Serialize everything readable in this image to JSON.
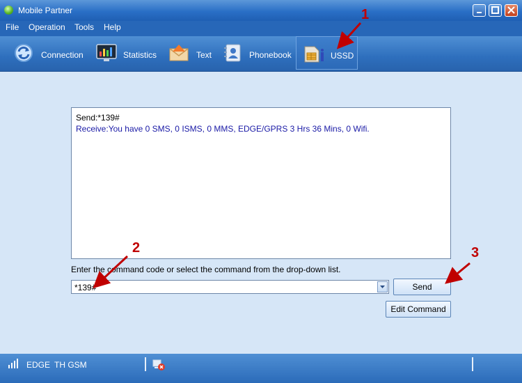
{
  "window": {
    "title": "Mobile Partner"
  },
  "menu": [
    {
      "label": "File"
    },
    {
      "label": "Operation"
    },
    {
      "label": "Tools"
    },
    {
      "label": "Help"
    }
  ],
  "toolbar": {
    "tabs": [
      {
        "label": "Connection",
        "icon": "connection-icon"
      },
      {
        "label": "Statistics",
        "icon": "statistics-icon"
      },
      {
        "label": "Text",
        "icon": "envelope-icon"
      },
      {
        "label": "Phonebook",
        "icon": "phonebook-icon"
      },
      {
        "label": "USSD",
        "icon": "ussd-sim-icon",
        "active": true
      }
    ]
  },
  "ussd": {
    "log": {
      "send_line": "Send:*139#",
      "receive_line": "Receive:You have 0 SMS, 0 ISMS, 0 MMS, EDGE/GPRS 3 Hrs 36 Mins, 0 Wifi."
    },
    "hint": "Enter the command code or select the command from the drop-down list.",
    "command_value": "*139#",
    "send_label": "Send",
    "edit_label": "Edit Command"
  },
  "status": {
    "network": "EDGE",
    "operator": "TH GSM"
  },
  "annotations": [
    "1",
    "2",
    "3"
  ],
  "colors": {
    "receive_text": "#1a1aa6",
    "annotation": "#c00000",
    "titlebar": "#2a6fc6"
  }
}
